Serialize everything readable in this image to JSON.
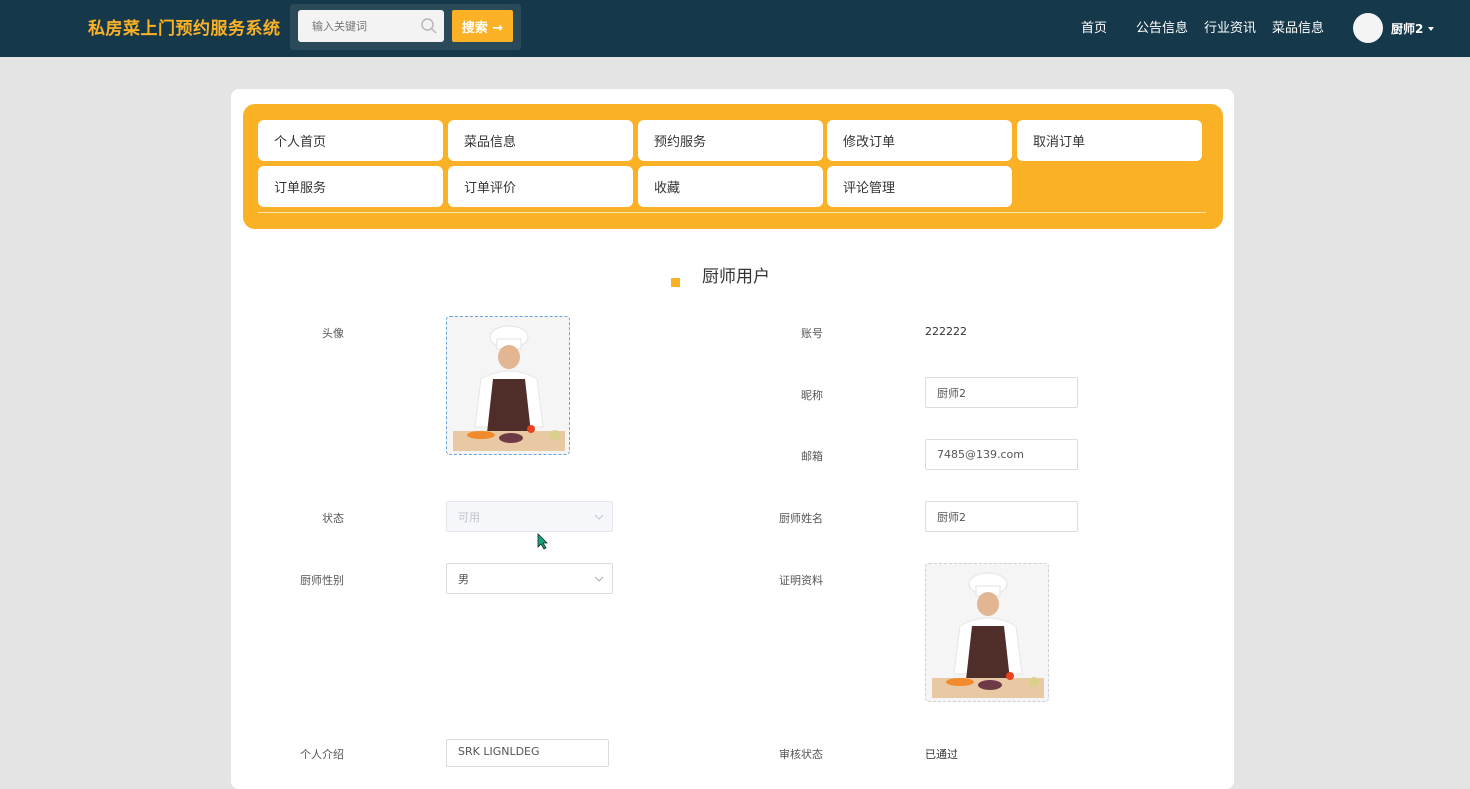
{
  "header": {
    "brand": "私房菜上门预约服务系统",
    "search_placeholder": "输入关键词",
    "search_button": "搜索 →",
    "nav": [
      "首页",
      "公告信息",
      "行业资讯",
      "菜品信息"
    ],
    "user_name": "厨师2"
  },
  "menu": {
    "row1": [
      "个人首页",
      "菜品信息",
      "预约服务",
      "修改订单",
      "取消订单"
    ],
    "row2": [
      "订单服务",
      "订单评价",
      "收藏",
      "评论管理"
    ]
  },
  "section_title": "厨师用户",
  "form": {
    "avatar_label": "头像",
    "account_label": "账号",
    "account_value": "222222",
    "nickname_label": "昵称",
    "nickname_value": "厨师2",
    "email_label": "邮箱",
    "email_value": "7485@139.com",
    "status_label": "状态",
    "status_value": "可用",
    "chef_name_label": "厨师姓名",
    "chef_name_value": "厨师2",
    "gender_label": "厨师性别",
    "gender_value": "男",
    "cert_label": "证明资料",
    "intro_label": "个人介绍",
    "intro_value": "SRK LIGNLDEG",
    "audit_label": "审核状态",
    "audit_value": "已通过"
  },
  "colors": {
    "topbar": "#15384a",
    "accent": "#fbb126",
    "page_bg": "#e4e4e4"
  }
}
